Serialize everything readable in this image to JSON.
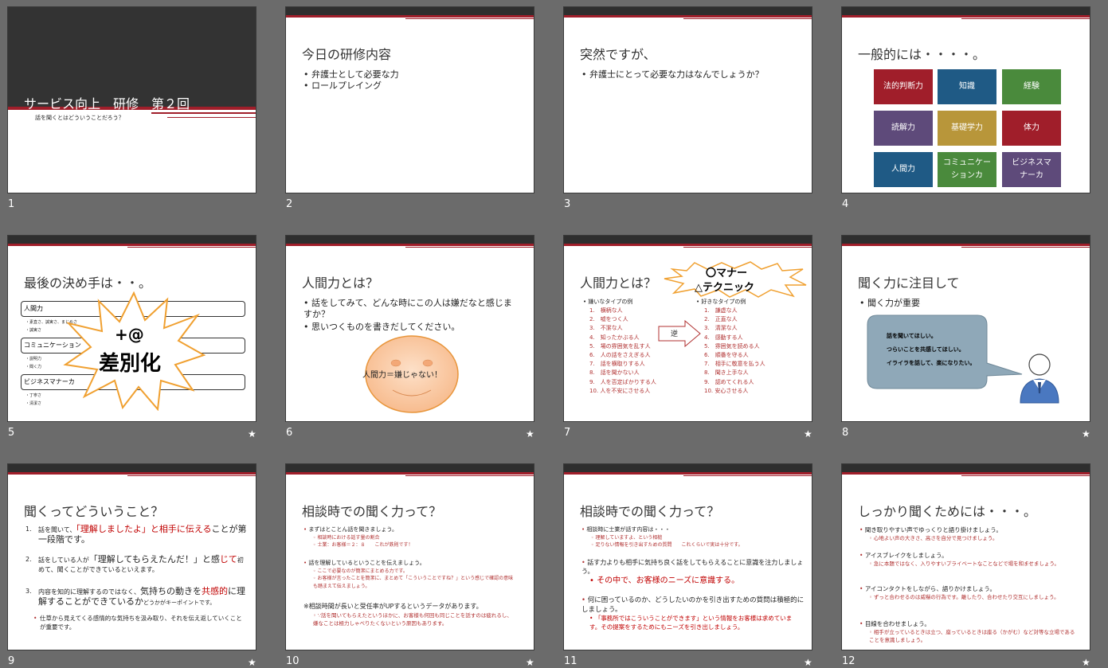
{
  "slides": [
    {
      "num": "1",
      "title": "サービス向上　研修　第２回",
      "bullet": "話を聞くとはどういうことだろう？"
    },
    {
      "num": "2",
      "title": "今日の研修内容",
      "bullets": [
        "弁護士として必要な力",
        "ロールプレイング"
      ]
    },
    {
      "num": "3",
      "title": "突然ですが、",
      "bullets": [
        "弁護士にとって必要な力はなんでしょうか？"
      ]
    },
    {
      "num": "4",
      "title": "一般的には・・・・。",
      "tiles": [
        "法的判断力",
        "知識",
        "経験",
        "読解力",
        "基礎学力",
        "体力",
        "人間力",
        "コミュニケーションカ",
        "ビジネスマナーカ"
      ]
    },
    {
      "num": "5",
      "title": "最後の決め手は・・。",
      "boxes": [
        "人間力",
        "コミュニケーション",
        "ビジネスマナーカ"
      ],
      "sub1": [
        "・素直さ、誠実さ、まじめさ",
        "・誠実さ"
      ],
      "sub2": [
        "・説明力",
        "・聞く力"
      ],
      "sub3": [
        "・丁寧さ",
        "・清潔さ"
      ],
      "burst1": "+@",
      "burst2": "差別化"
    },
    {
      "num": "6",
      "title": "人間力とは？",
      "bullets": [
        "話をしてみて、どんな時にこの人は嫌だなと感じますか？",
        "思いつくものを書きだしてください。"
      ],
      "face": "人間力＝嫌じゃない！"
    },
    {
      "num": "7",
      "title": "人間力とは？",
      "burst1": "〇マナー",
      "burst2": "△テクニック",
      "left_head": "嫌いなタイプの例",
      "left": [
        "横柄な人",
        "嘘をつく人",
        "不潔な人",
        "知ったかぶる人",
        "場の雰囲気を乱す人",
        "人の話をさえぎる人",
        "話を横取りする人",
        "話を聞かない人",
        "人を否定ばかりする人",
        "人を不安にさせる人"
      ],
      "arrow": "逆",
      "right_head": "好きなタイプの例",
      "right": [
        "謙虚な人",
        "正直な人",
        "清潔な人",
        "感動する人",
        "雰囲気を読める人",
        "順番を守る人",
        "相手に敬意を払う人",
        "聞き上手な人",
        "認めてくれる人",
        "安心させる人"
      ]
    },
    {
      "num": "8",
      "title": "聞く力に注目して",
      "bullets": [
        "聞く力が重要"
      ],
      "bubble": [
        "話を聞いてほしい。",
        "つらいことを共感してほしい。",
        "イライラを話して、楽になりたい。"
      ]
    },
    {
      "num": "9",
      "title": "聞くってどういうこと？"
    },
    {
      "num": "10",
      "title": "相談時での聞く力って？"
    },
    {
      "num": "11",
      "title": "相談時での聞く力って？"
    },
    {
      "num": "12",
      "title": "しっかり聞くためには・・・。"
    }
  ],
  "s9": {
    "p1a": "話を聞いて、",
    "p1b": "「理解しましたよ」と相手に伝える",
    "p1c": "ことが第一段階です。",
    "p2a": "話をしている人が",
    "p2b": "「理解してもらえたんだ！」と感",
    "p2c": "じて",
    "p2d": "初めて、聞くことができているといえます。",
    "p3a": "内容を知的に理解するのではなく、",
    "p3b": "気持ちの動きを",
    "p3c": "共感的",
    "p3d": "に理解することができているか",
    "p3e": "どうかがキーポイントです。",
    "p4": "仕草から見えてくる感情的な気持ちを汲み取り、それを伝え返していくことが重要です。"
  },
  "s10": {
    "b1": "まずはとことん話を聞きましょう。",
    "b1s1": "相談時における話す量の割合",
    "b1s2": "士業：お客様＝２：８　　これが鉄則です！",
    "b2": "話を理解しているということを伝えましょう。",
    "b2s1": "ここで必要なのが簡潔にまとめる力です。",
    "b2s2": "お客様が言ったことを簡潔に、まとめて「こういうことですね？」という感じで確認の意味も踏まえて伝えましょう。",
    "b3": "※相談時間が長いと受任率がUPするというデータがあります。",
    "b3s1": "∵話を聞いてもらえたというほかに、お客様も何回も同じことを話すのは疲れるし、嫌なことは極力しゃべりたくないという原因もあります。"
  },
  "s11": {
    "b1": "相談時に士業が話す内容は・・・",
    "b1s1": "理解していますよ、という相槌",
    "b1s2": "足りない情報を引き出すための質問　　これくらいで実は十分です。",
    "b2": "話す力よりも相手に気持ち良く話をしてもらえることに意識を注力しましょう。",
    "b2r": "その中で、お客様のニーズに意識する。",
    "b3": "何に困っているのか、どうしたいのかを引き出すための質問は積極的にしましょう。",
    "b3r": "「事務所ではこういうことができます」という情報をお客様は求めています。その提案をするためにもニーズを引き出しましょう。"
  },
  "s12": {
    "b1": "聞き取りやすい声でゆっくりと語り掛けましょう。",
    "b1s": "心地よい声の大きさ、高さを自分で見つけましょう。",
    "b2": "アイスブレイクをしましょう。",
    "b2s": "急に本題ではなく、入りやすいプライベートなことなどで場を和ませましょう。",
    "b3": "アイコンタクトをしながら、語りかけましょう。",
    "b3s": "ずっと合わせるのは威嚇の行為です。離したり、合わせたり交互にしましょう。",
    "b4": "目線を合わせましょう。",
    "b4s": "相手が立っているときは立つ、座っているときは座る（かがむ）など対等な立場であることを意識しましょう。"
  },
  "star": "★",
  "colors": {
    "red": "#a01e2a",
    "blue": "#1f4e79",
    "green": "#4a8a3c",
    "purple": "#5e4a7a",
    "gold": "#b8963a",
    "teal": "#2a8a6e"
  }
}
